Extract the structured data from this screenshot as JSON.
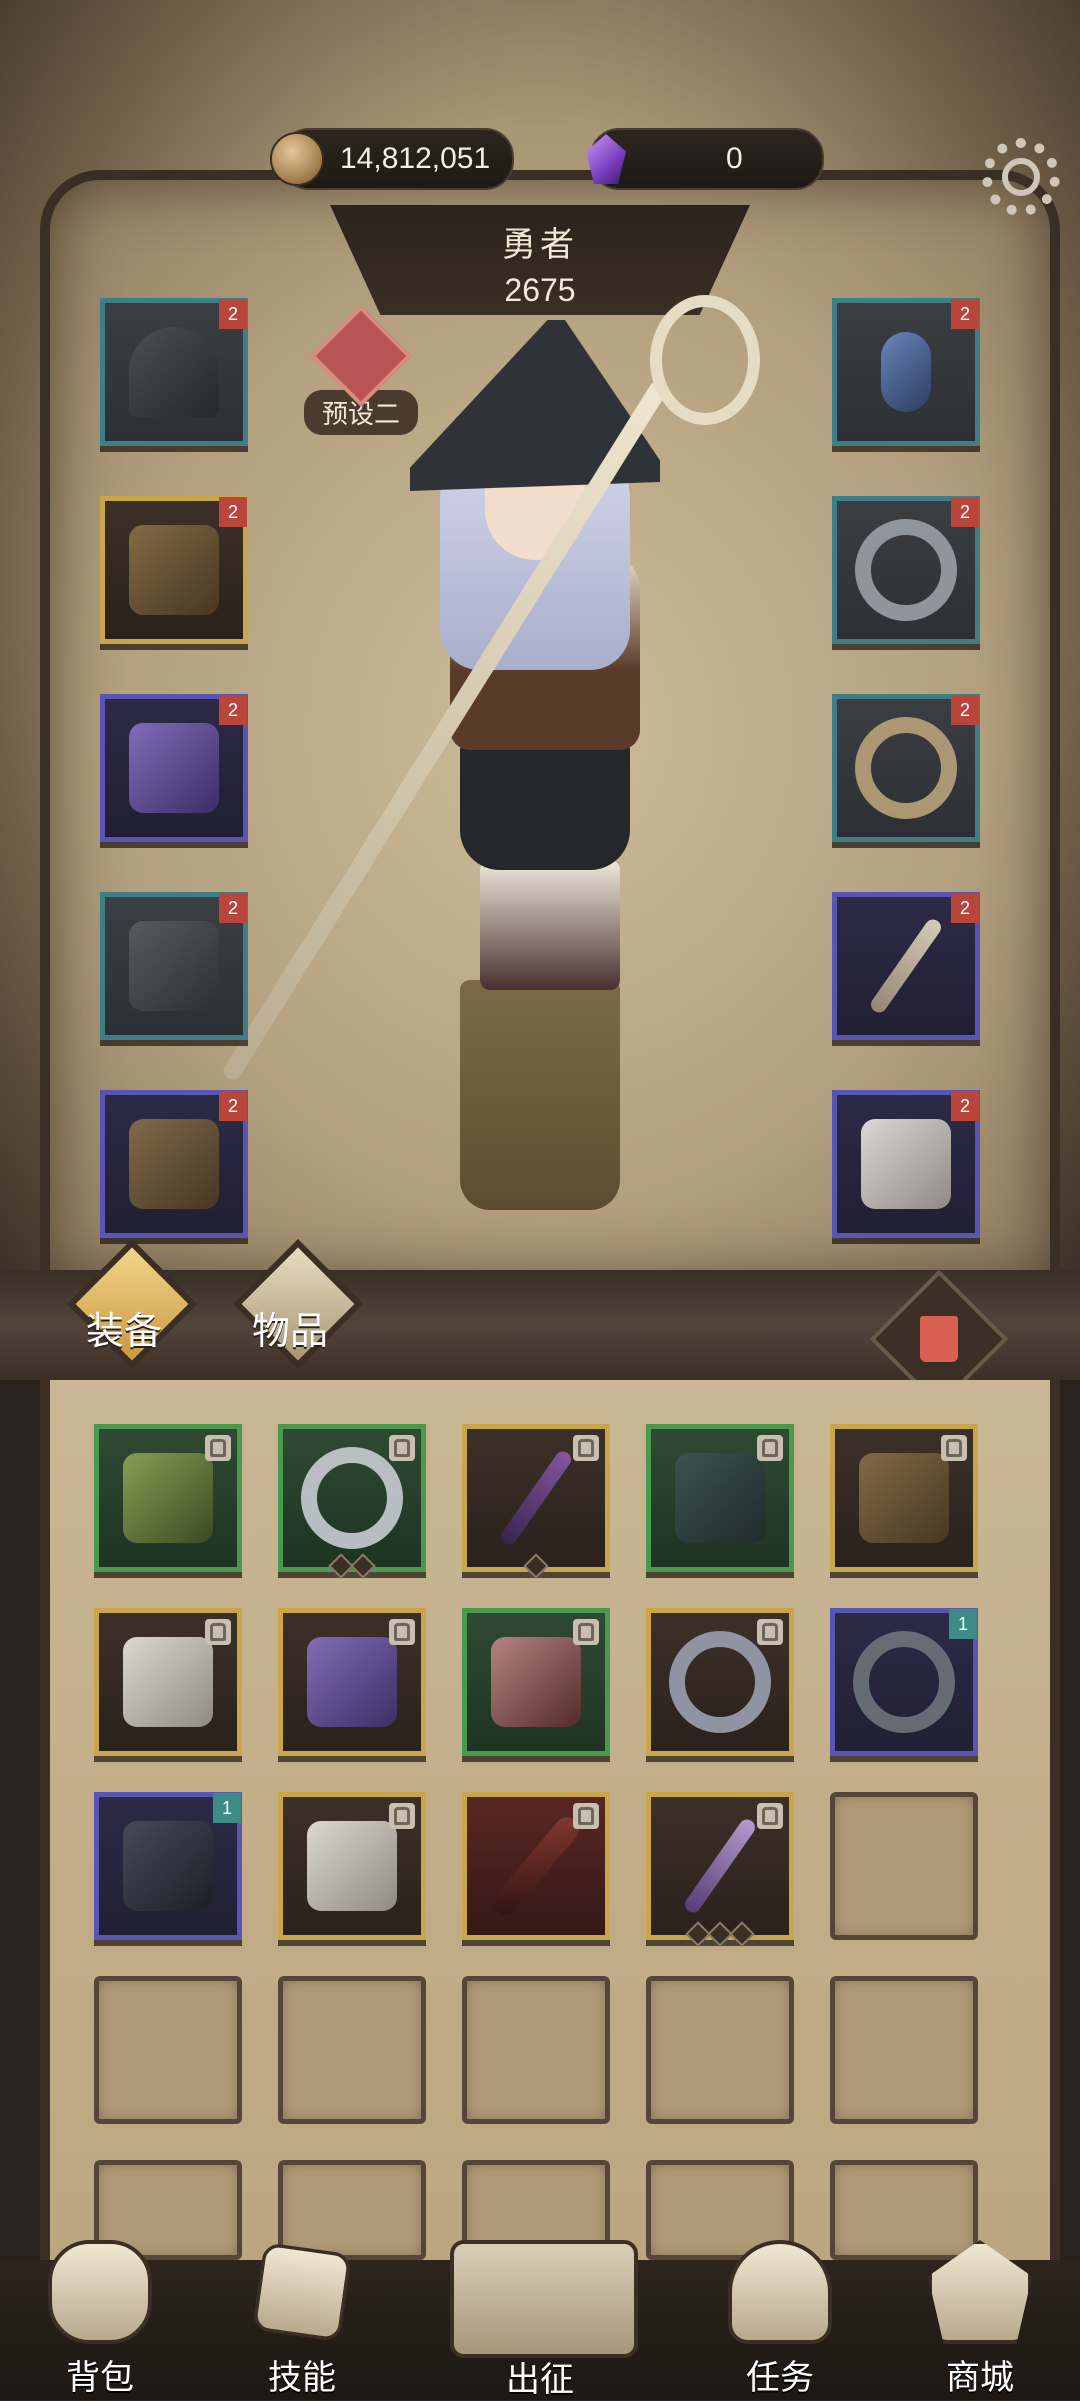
{
  "currency": {
    "gold": "14,812,051",
    "gems": "0"
  },
  "hero": {
    "title": "勇者",
    "power": "2675",
    "preset": "预设二"
  },
  "equip_left": [
    {
      "slot": "helmet",
      "rarity": "teal",
      "badge": "2"
    },
    {
      "slot": "armor",
      "rarity": "gold",
      "badge": "2"
    },
    {
      "slot": "gloves",
      "rarity": "purple",
      "badge": "2"
    },
    {
      "slot": "pants",
      "rarity": "teal",
      "badge": "2"
    },
    {
      "slot": "boots",
      "rarity": "purple",
      "badge": "2"
    }
  ],
  "equip_right": [
    {
      "slot": "necklace",
      "rarity": "teal",
      "badge": "2"
    },
    {
      "slot": "ring",
      "rarity": "teal",
      "badge": "2"
    },
    {
      "slot": "ring-2",
      "rarity": "teal",
      "badge": "2"
    },
    {
      "slot": "weapon",
      "rarity": "purple",
      "badge": "2"
    },
    {
      "slot": "offhand",
      "rarity": "purple",
      "badge": "2"
    }
  ],
  "tabs": {
    "equipment": "装备",
    "items": "物品"
  },
  "inventory": [
    {
      "rarity": "green",
      "locked": true
    },
    {
      "rarity": "green",
      "locked": true,
      "dots": 2
    },
    {
      "rarity": "gold",
      "locked": true,
      "dots": 1
    },
    {
      "rarity": "green",
      "locked": true
    },
    {
      "rarity": "gold",
      "locked": true
    },
    {
      "rarity": "gold",
      "locked": true
    },
    {
      "rarity": "gold",
      "locked": true
    },
    {
      "rarity": "green",
      "locked": true
    },
    {
      "rarity": "gold",
      "locked": true
    },
    {
      "rarity": "purple",
      "badge": "1"
    },
    {
      "rarity": "purple",
      "badge": "1"
    },
    {
      "rarity": "gold",
      "locked": true
    },
    {
      "rarity": "red",
      "locked": true
    },
    {
      "rarity": "gold",
      "locked": true,
      "dots": 3
    }
  ],
  "nav": {
    "bag": "背包",
    "skills": "技能",
    "battle": "出征",
    "quests": "任务",
    "shop": "商城"
  },
  "colors": {
    "teal": "#3e7e86",
    "gold": "#c9a64c",
    "purple": "#5a55b5",
    "green": "#4a9a4e",
    "badge_red": "#b8463d"
  }
}
